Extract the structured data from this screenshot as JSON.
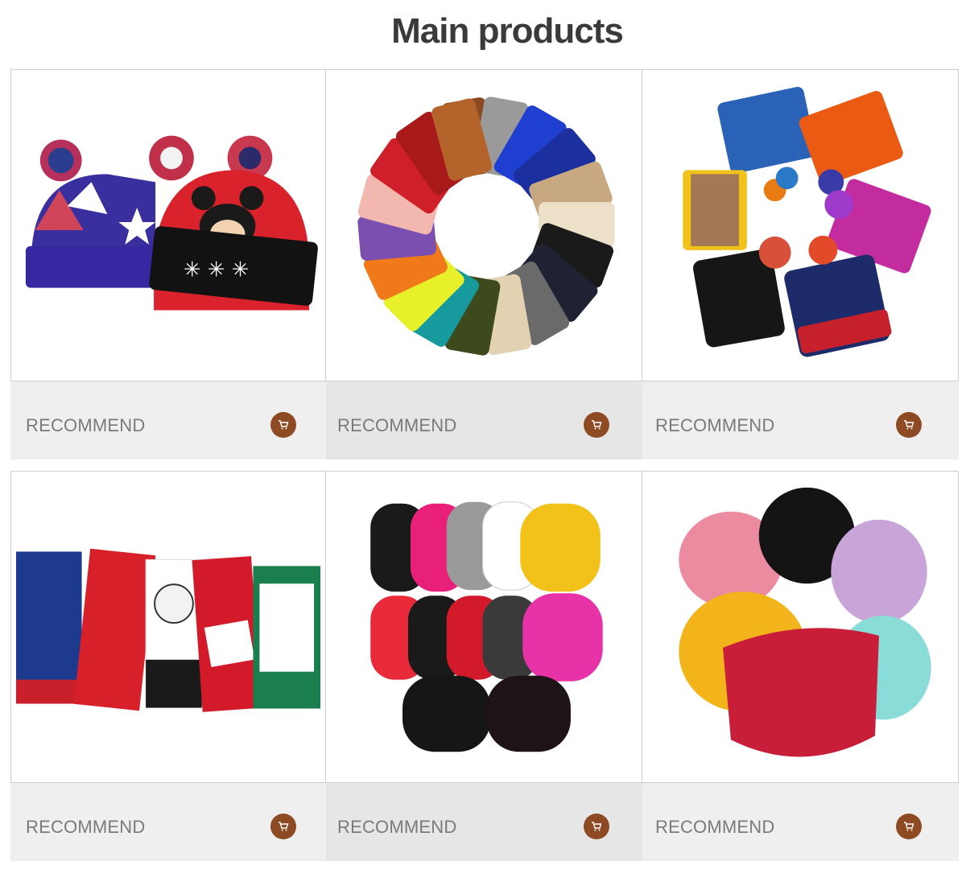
{
  "header": {
    "title": "Main products"
  },
  "products": [
    {
      "image_icon": "pompom-beanies-image",
      "label": "RECOMMEND",
      "cart_icon": "shopping-cart-icon"
    },
    {
      "image_icon": "color-beanies-circle-image",
      "label": "RECOMMEND",
      "cart_icon": "shopping-cart-icon"
    },
    {
      "image_icon": "jacquard-logo-beanies-image",
      "label": "RECOMMEND",
      "cart_icon": "shopping-cart-icon"
    },
    {
      "image_icon": "knitted-scarves-image",
      "label": "RECOMMEND",
      "cart_icon": "shopping-cart-icon"
    },
    {
      "image_icon": "spiderweb-beanies-image",
      "label": "RECOMMEND",
      "cart_icon": "shopping-cart-icon"
    },
    {
      "image_icon": "tufted-letter-beanies-image",
      "label": "RECOMMEND",
      "cart_icon": "shopping-cart-icon"
    }
  ],
  "colors": {
    "cart_button": "#8e4a22",
    "bar": "#efefef",
    "label": "#7a7a7a",
    "title": "#3a3a3a"
  }
}
